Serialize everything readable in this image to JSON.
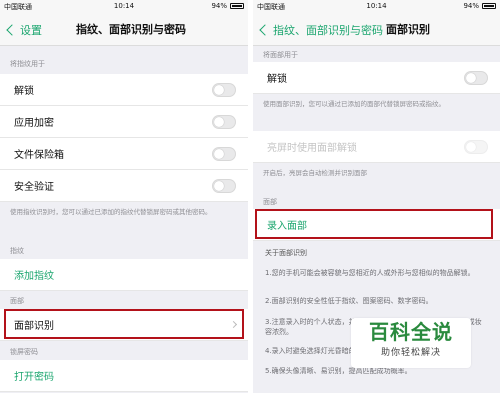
{
  "status_bar": {
    "carrier": "中国联通",
    "time": "10:14",
    "battery": "94%"
  },
  "colors": {
    "accent": "#1aa56e",
    "highlight": "#b3121a",
    "background": "#efeff4"
  },
  "left_screen": {
    "back_label": "设置",
    "title": "指纹、面部识别与密码",
    "fingerprint_use_header": "将指纹用于",
    "toggle_rows": [
      "解锁",
      "应用加密",
      "文件保险箱",
      "安全验证"
    ],
    "fingerprint_note": "使用指纹识别时，您可以通过已添加的指纹代替锁屏密码或其他密码。",
    "fingerprint_header": "指纹",
    "add_fingerprint": "添加指纹",
    "face_header": "面部",
    "face_recognition": "面部识别",
    "lockscreen_header": "锁屏密码",
    "open_password": "打开密码"
  },
  "right_screen": {
    "back_label": "指纹、面部识别与密码",
    "title": "面部识别",
    "face_use_header": "将面部用于",
    "unlock_label": "解锁",
    "unlock_note": "使用面部识别，您可以通过已添加的面部代替锁屏密码或指纹。",
    "screen_on_unlock": "亮屏时使用面部解锁",
    "screen_on_note": "开启后，亮屏会自动检测并识别面部",
    "face_header": "面部",
    "enroll_face": "录入面部",
    "about_header": "关于面部识别",
    "about_items": [
      "1.您的手机可能会被容貌与您相近的人或外形与您相似的物品解锁。",
      "2.面部识别的安全性低于指纹、图案密码、数字密码。",
      "3.注意录入时的个人状态，并避免戴帽子、眼镜等遮挡面部及浓妆或妆容浓烈。",
      "4.录入时避免选择灯光昏暗的环境。",
      "5.确保头像清晰、易识别，提高匹配成功概率。"
    ]
  },
  "watermark": {
    "title": "百科全说",
    "subtitle": "助你轻松解决"
  }
}
